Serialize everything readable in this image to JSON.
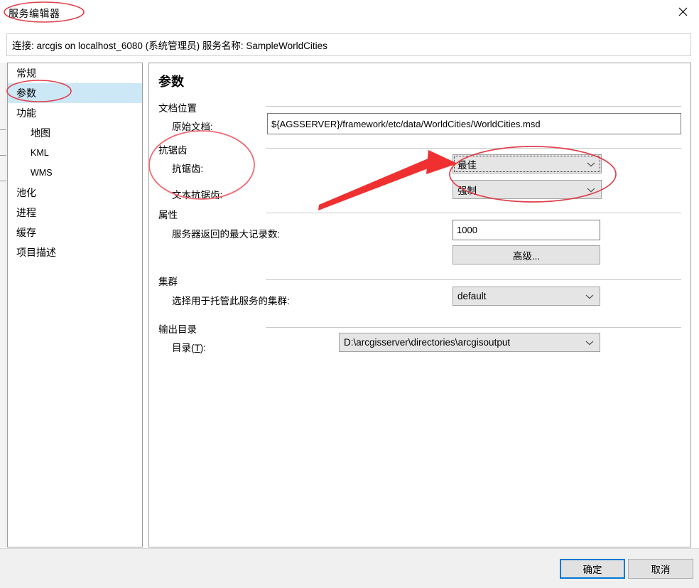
{
  "window": {
    "title": "服务编辑器",
    "close_icon": "close-icon"
  },
  "connection_bar": {
    "text": "连接: arcgis on localhost_6080 (系统管理员)   服务名称: SampleWorldCities"
  },
  "sidebar": {
    "items": [
      {
        "label": "常规",
        "indent": false,
        "selected": false,
        "latin": false
      },
      {
        "label": "参数",
        "indent": false,
        "selected": true,
        "latin": false
      },
      {
        "label": "功能",
        "indent": false,
        "selected": false,
        "latin": false
      },
      {
        "label": "地图",
        "indent": true,
        "selected": false,
        "latin": false
      },
      {
        "label": "KML",
        "indent": true,
        "selected": false,
        "latin": true
      },
      {
        "label": "WMS",
        "indent": true,
        "selected": false,
        "latin": true
      },
      {
        "label": "池化",
        "indent": false,
        "selected": false,
        "latin": false
      },
      {
        "label": "进程",
        "indent": false,
        "selected": false,
        "latin": false
      },
      {
        "label": "缓存",
        "indent": false,
        "selected": false,
        "latin": false
      },
      {
        "label": "项目描述",
        "indent": false,
        "selected": false,
        "latin": false
      }
    ]
  },
  "main": {
    "page_title": "参数",
    "groups": {
      "doc_location": "文档位置",
      "antialias": "抗锯齿",
      "properties": "属性",
      "cluster": "集群",
      "output_dir": "输出目录"
    },
    "labels": {
      "source_doc": "原始文档:",
      "antialias": "抗锯齿:",
      "text_antialias": "文本抗锯齿:",
      "max_records": "服务器返回的最大记录数:",
      "cluster_select": "选择用于托管此服务的集群:",
      "directory_prefix": "目录(",
      "directory_accel": "T",
      "directory_suffix": "):"
    },
    "values": {
      "source_doc": "${AGSSERVER}/framework/etc/data/WorldCities/WorldCities.msd",
      "antialias": "最佳",
      "text_antialias": "强制",
      "max_records": "1000",
      "cluster": "default",
      "directory": "D:\\arcgisserver\\directories\\arcgisoutput"
    },
    "buttons": {
      "advanced": "高级..."
    }
  },
  "footer": {
    "ok": "确定",
    "cancel": "取消"
  },
  "annotations": {
    "color": "#e0414b",
    "arrow_color": "#f03030",
    "ellipse_title": "服务编辑器",
    "ellipse_sidebar": "参数",
    "ellipse_antialias_labels": "抗锯齿",
    "ellipse_antialias_combos": "最佳 / 强制"
  }
}
